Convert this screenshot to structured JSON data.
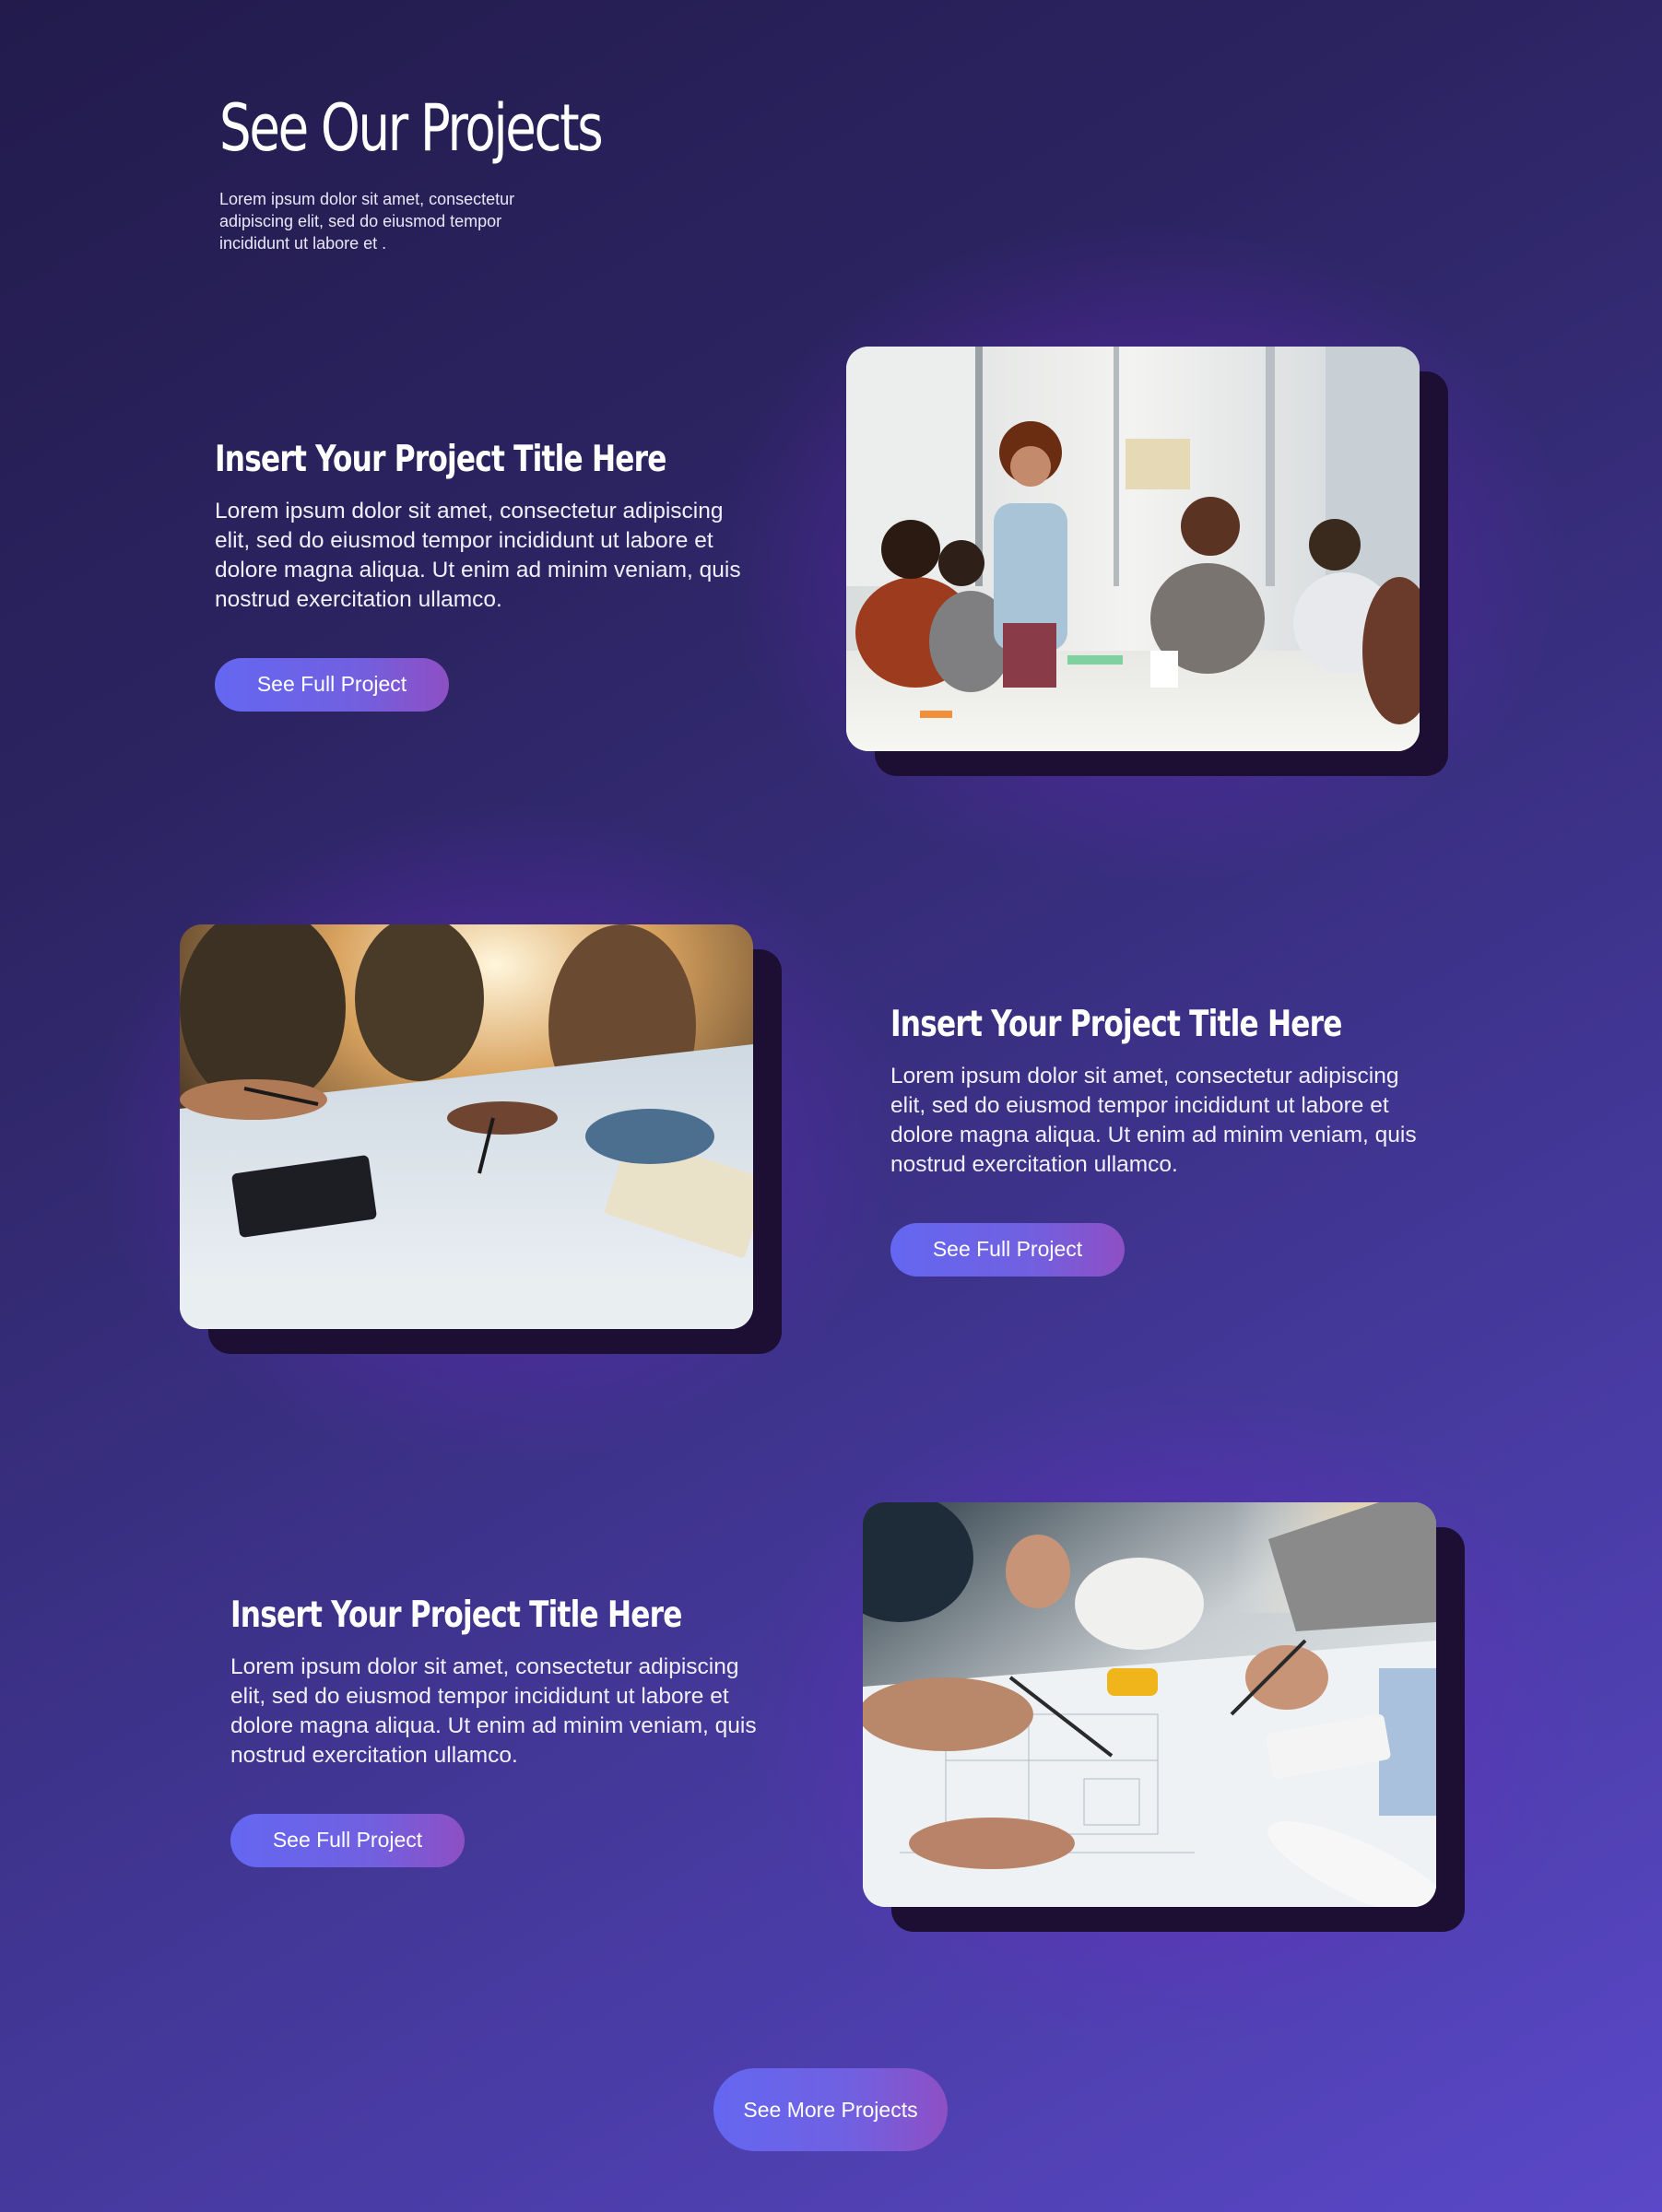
{
  "intro": {
    "title": "See Our Projects",
    "text": "Lorem ipsum dolor sit amet, consectetur adipiscing elit, sed do eiusmod tempor incididunt ut labore et ."
  },
  "projects": [
    {
      "title": "Insert Your Project Title Here",
      "description": "Lorem ipsum dolor sit amet, consectetur adipiscing elit, sed do eiusmod tempor incididunt ut labore et dolore magna aliqua. Ut enim ad minim veniam, quis nostrud exercitation ullamco.",
      "button_label": "See Full Project"
    },
    {
      "title": "Insert Your Project Title Here",
      "description": "Lorem ipsum dolor sit amet, consectetur adipiscing elit, sed do eiusmod tempor incididunt ut labore et dolore magna aliqua. Ut enim ad minim veniam, quis nostrud exercitation ullamco.",
      "button_label": "See Full Project"
    },
    {
      "title": "Insert Your Project Title Here",
      "description": "Lorem ipsum dolor sit amet, consectetur adipiscing elit, sed do eiusmod tempor incididunt ut labore et dolore magna aliqua. Ut enim ad minim veniam, quis nostrud exercitation ullamco.",
      "button_label": "See Full Project"
    }
  ],
  "more_button": {
    "label": "See More Projects"
  },
  "colors": {
    "background_start": "#221b4c",
    "background_end": "#5a48c8",
    "button_start": "#6467f2",
    "button_end": "#8e4fc4",
    "image_shadow": "#1c0f33"
  }
}
